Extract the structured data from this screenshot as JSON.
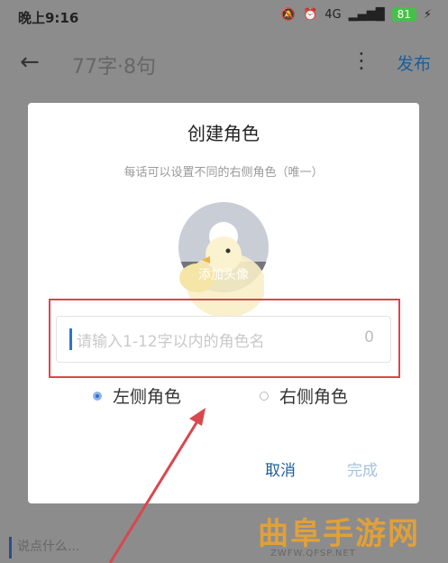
{
  "status_bar": {
    "time": "晚上9:16",
    "network": "4G",
    "battery": "81"
  },
  "app_bar": {
    "back_icon": "back-arrow-icon",
    "title": "77字·8句",
    "more_icon": "more-vert-icon",
    "publish_label": "发布"
  },
  "background": {
    "input_placeholder": "说点什么..."
  },
  "dialog": {
    "title": "创建角色",
    "subtitle": "每话可以设置不同的右侧角色（唯一）",
    "avatar_label": "添加头像",
    "name_placeholder": "请输入1-12字以内的角色名",
    "name_count": "0",
    "options": [
      {
        "label": "左侧角色",
        "selected": true
      },
      {
        "label": "右侧角色",
        "selected": false
      }
    ],
    "cancel_label": "取消",
    "done_label": "完成"
  },
  "annotation": {
    "color": "#d9474f"
  },
  "watermark": {
    "text": "曲阜手游网",
    "url": "ZWFW.QFSP.NET"
  }
}
